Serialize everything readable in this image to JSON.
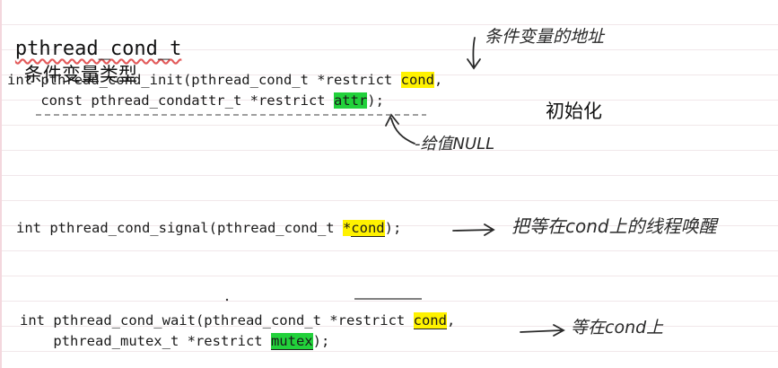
{
  "title": {
    "code": "pthread_cond_t",
    "label": "条件变量类型"
  },
  "init": {
    "line1": {
      "prefix": "int pthread_cond_init(pthread_cond_t *restrict ",
      "hl": "cond",
      "suffix": ","
    },
    "line2": {
      "prefix": "    const pthread_condattr_t *restrict ",
      "hl": "attr",
      "suffix": ");"
    },
    "label": "初始化",
    "note_cond": "条件变量的地址",
    "note_attr": "-给值NULL"
  },
  "signal": {
    "prefix": "int pthread_cond_signal(pthread_cond_t ",
    "star": "*",
    "hl": "cond",
    "suffix": ");",
    "note": "把等在cond上的线程唤醒"
  },
  "wait": {
    "line1": {
      "prefix": "int pthread_cond_wait(pthread_cond_t *restrict ",
      "hl": "cond",
      "suffix": ","
    },
    "line2": {
      "prefix": "    pthread_mutex_t *restrict ",
      "hl": "mutex",
      "suffix": ");"
    },
    "note": "等在cond上"
  },
  "colors": {
    "highlight_yellow": "#fff200",
    "highlight_green": "#22d13b",
    "wavy_underline": "#e25a5a"
  }
}
